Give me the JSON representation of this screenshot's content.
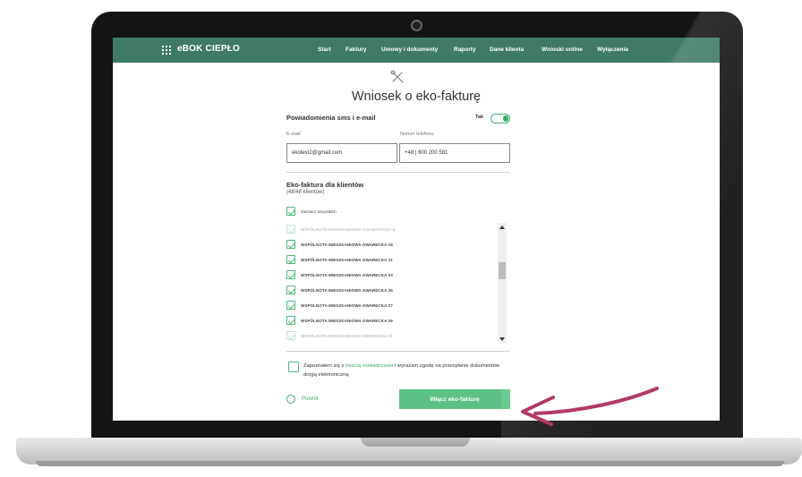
{
  "nav": {
    "logo": "eBOK CIEPŁO",
    "items": [
      "Start",
      "Faktury",
      "Umowy i dokumenty",
      "Raporty",
      "Dane klienta",
      "Wnioski online",
      "Wyłączenia"
    ]
  },
  "page": {
    "title": "Wniosek o eko-fakturę"
  },
  "notifications": {
    "title": "Powiadomienia sms i e-mail",
    "toggle_label": "Tak",
    "toggle_on": true,
    "email_label": "E-mail",
    "email_value": "ekotest2@gmail.com",
    "phone_label": "Numer telefonu",
    "phone_value": "+48 | 600 200 581"
  },
  "eko": {
    "title": "Eko-faktura dla klientów",
    "subtitle": "(48/48 klientów)",
    "select_all_label": "Zaznacz wszystkich",
    "clients": [
      "WSPÓLNOTA MIESZKANIOWA GOLĘDZYCKA 9",
      "WSPÓLNOTA MIESZKANIOWA GWARECKA 19",
      "WSPÓLNOTA MIESZKANIOWA GWARECKA 21",
      "WSPÓLNOTA MIESZKANIOWA GWARECKA 23",
      "WSPÓLNOTA MIESZKANIOWA GWARECKA 25",
      "WSPÓLNOTA MIESZKANIOWA GWARECKA 27",
      "WSPÓLNOTA MIESZKANIOWA GWARECKA 29",
      "WSPÓLNOTA MIESZKANIOWA GWARECKA 31"
    ]
  },
  "consent": {
    "before": "Zapoznałem się z ",
    "link": "treścią oświadczenia",
    "after": " i wyrażam zgodę na przesyłanie dokumentów drogą elektroniczną"
  },
  "actions": {
    "back_label": "Powrót",
    "submit_label": "Włącz eko-fakturę"
  },
  "colors": {
    "nav_bg": "#3f7a67",
    "accent": "#5cc183",
    "annotation_arrow": "#b03a68"
  }
}
